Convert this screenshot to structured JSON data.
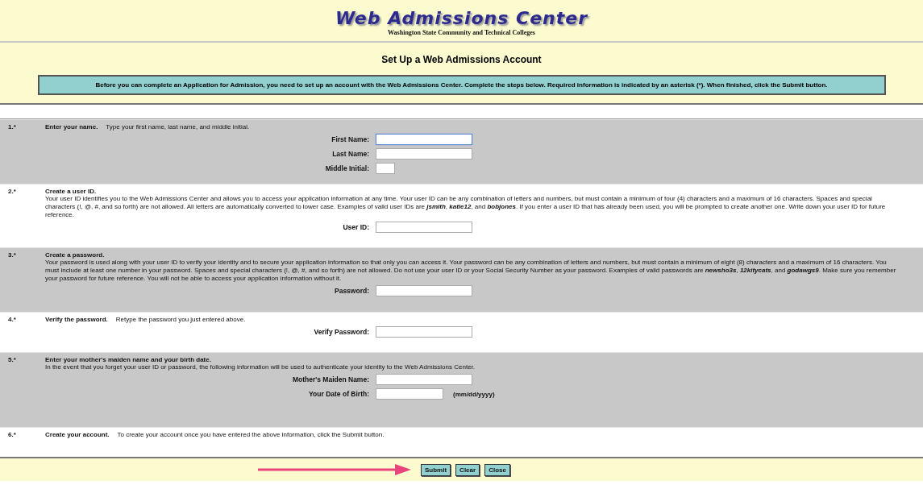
{
  "header": {
    "title": "Web Admissions Center",
    "subtitle": "Washington State Community and Technical Colleges"
  },
  "page_title": "Set Up a Web Admissions Account",
  "notice": "Before you can complete an Application for Admission, you need to set up an account with the Web Admissions Center. Complete the steps below. Required information is indicated by an asterisk (*). When finished, click the Submit button.",
  "steps": [
    {
      "number": "1.*",
      "kind": "inline",
      "title": "Enter your name.",
      "description": "Type your first name, last name, and middle initial.",
      "fields": [
        {
          "label": "First Name:",
          "kind": "text",
          "focused": true
        },
        {
          "label": "Last Name:",
          "kind": "text",
          "focused": false
        },
        {
          "label": "Middle Initial:",
          "kind": "initial",
          "focused": false
        }
      ]
    },
    {
      "number": "2.*",
      "kind": "block",
      "title": "Create a user ID.",
      "description": "Your user ID identifies you to the Web Admissions Center and allows you to access your application information at any time. Your user ID can be any combination of letters and numbers, but must contain a minimum of four (4) characters and a maximum of 16 characters. Spaces and special characters (!, @, #, and so forth) are not allowed. All letters are automatically converted to lower case. Examples of valid user IDs are *jsmith*, *katie12*, and *bobjones*. If you enter a user ID that has already been used, you will be prompted to create another one. Write down your user ID for future reference.",
      "fields": [
        {
          "label": "User ID:",
          "kind": "text",
          "focused": false
        }
      ]
    },
    {
      "number": "3.*",
      "kind": "block",
      "title": "Create a password.",
      "description": "Your password is used along with your user ID to verify your identity and to secure your application information so that only you can access it. Your password can be any combination of letters and numbers, but must contain a minimum of eight (8) characters and a maximum of 16 characters. You must include at least one number in your password. Spaces and special characters (!, @, #, and so forth) are not allowed. Do not use your user ID or your Social Security Number as your password. Examples of valid passwords are *newsho3s*, *12kitycats*, and *godawgs9*. Make sure you remember your password for future reference. You will not be able to access your application information without it.",
      "fields": [
        {
          "label": "Password:",
          "kind": "text",
          "focused": false
        }
      ]
    },
    {
      "number": "4.*",
      "kind": "inline",
      "title": "Verify the password.",
      "description": "Retype the password you just entered above.",
      "fields": [
        {
          "label": "Verify Password:",
          "kind": "text",
          "focused": false
        }
      ]
    },
    {
      "number": "5.*",
      "kind": "block",
      "title": "Enter your mother's maiden name and your birth date.",
      "description": "In the event that you forget your user ID or password, the following information will be used to authenticate your identity to the Web Admissions Center.",
      "fields": [
        {
          "label": "Mother's Maiden Name:",
          "kind": "text",
          "focused": false
        },
        {
          "label": "Your Date of Birth:",
          "kind": "date",
          "focused": false,
          "hint": "(mm/dd/yyyy)"
        }
      ]
    },
    {
      "number": "6.*",
      "kind": "inline",
      "title": "Create your account.",
      "description": "To create your account once you have entered the above information, click the Submit button."
    }
  ],
  "buttons": [
    "Submit",
    "Clear",
    "Close"
  ]
}
